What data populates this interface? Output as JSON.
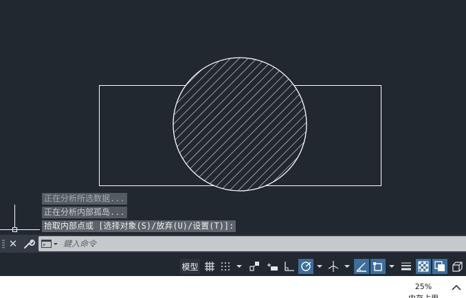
{
  "theme": {
    "canvas_bg": "#212830",
    "accent_blue": "#3d6e9c",
    "geometry_stroke": "#ffffff"
  },
  "drawing": {
    "objects": [
      {
        "type": "rectangle"
      },
      {
        "type": "circle",
        "fill": "hatch-ANSI31"
      }
    ]
  },
  "command_history": [
    "正在分析所选数据...",
    "正在分析内部孤岛...",
    "拾取内部点或 [选择对象(S)/放弃(U)/设置(T)]:"
  ],
  "command_line": {
    "placeholder": "鍵入命令",
    "value": ""
  },
  "status_bar": {
    "model_label": "模型",
    "tools": [
      {
        "icon": "grid-icon",
        "active": false
      },
      {
        "icon": "snap-icon",
        "active": false,
        "has_dropdown": true
      },
      {
        "icon": "infer-constraints-icon",
        "active": false
      },
      {
        "icon": "dynamic-input-icon",
        "active": false
      },
      {
        "icon": "ortho-icon",
        "active": false
      },
      {
        "icon": "polar-tracking-icon",
        "active": true,
        "has_dropdown": true
      },
      {
        "icon": "isometric-icon",
        "active": false,
        "has_dropdown": true
      },
      {
        "icon": "object-snap-tracking-icon",
        "active": true
      },
      {
        "icon": "object-snap-icon",
        "active": true,
        "has_dropdown": true
      },
      {
        "icon": "lineweight-icon",
        "active": false
      },
      {
        "icon": "transparency-icon",
        "active": true
      },
      {
        "icon": "selection-cycling-icon",
        "active": true
      },
      {
        "icon": "3d-object-snap-icon",
        "active": false
      }
    ]
  },
  "taskbar": {
    "memory_percent": "25%",
    "memory_label": "内存占用"
  }
}
